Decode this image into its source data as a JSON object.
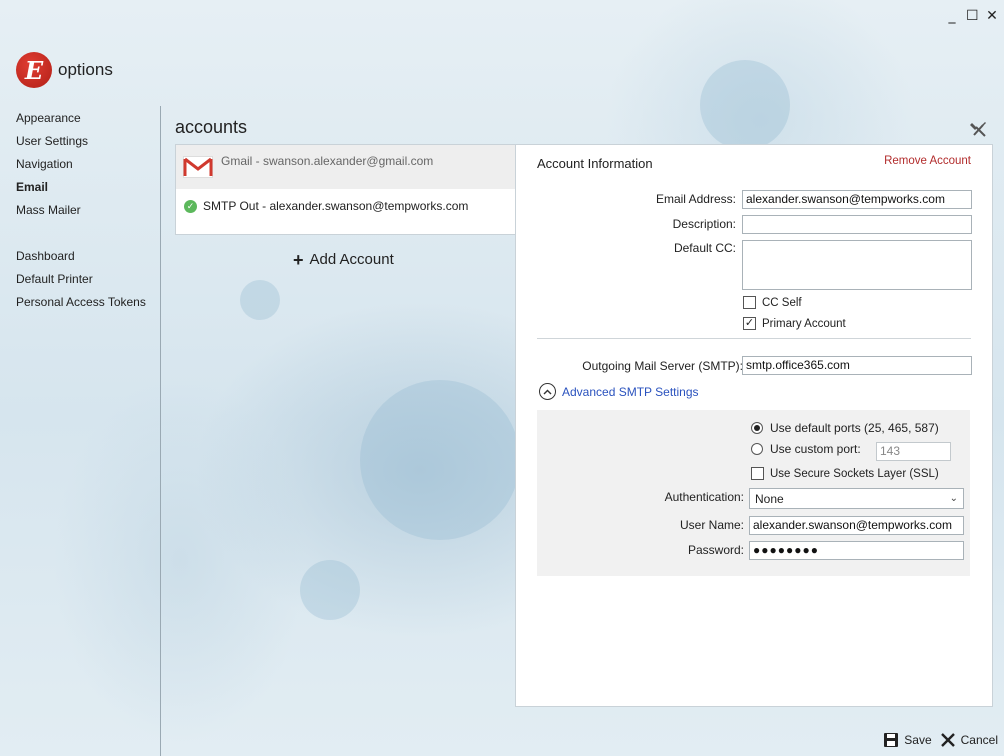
{
  "window": {
    "minimize_icon": "minimize-icon",
    "maximize_icon": "maximize-icon",
    "close_icon": "close-icon"
  },
  "app": {
    "logo_letter": "E",
    "title": "options",
    "brand_color": "#c8261d"
  },
  "sidebar": {
    "items": [
      {
        "label": "Appearance",
        "active": false
      },
      {
        "label": "User Settings",
        "active": false
      },
      {
        "label": "Navigation",
        "active": false
      },
      {
        "label": "Email",
        "active": true
      },
      {
        "label": "Mass Mailer",
        "active": false
      },
      {
        "label": "Dashboard",
        "active": false
      },
      {
        "label": "Default Printer",
        "active": false
      },
      {
        "label": "Personal Access Tokens",
        "active": false
      }
    ]
  },
  "accounts": {
    "title": "accounts",
    "list": [
      {
        "label": "Gmail - swanson.alexander@gmail.com",
        "icon": "gmail-icon",
        "selected": true
      },
      {
        "label": "SMTP Out - alexander.swanson@tempworks.com",
        "icon": "check-circle-icon",
        "selected": false
      }
    ],
    "add_label": "Add Account"
  },
  "account_info": {
    "heading": "Account Information",
    "remove_label": "Remove Account",
    "email_label": "Email Address:",
    "email_value": "alexander.swanson@tempworks.com",
    "description_label": "Description:",
    "description_value": "",
    "cc_label": "Default CC:",
    "cc_value": "",
    "cc_self_label": "CC Self",
    "cc_self_checked": false,
    "primary_label": "Primary Account",
    "primary_checked": true,
    "smtp_label": "Outgoing Mail Server (SMTP):",
    "smtp_value": "smtp.office365.com",
    "advanced_label": "Advanced SMTP Settings"
  },
  "advanced": {
    "default_ports_label": "Use default ports (25, 465, 587)",
    "default_ports_selected": true,
    "custom_port_label": "Use custom port:",
    "custom_port_value": "143",
    "ssl_label": "Use Secure Sockets Layer (SSL)",
    "ssl_checked": false,
    "auth_label": "Authentication:",
    "auth_value": "None",
    "username_label": "User Name:",
    "username_value": "alexander.swanson@tempworks.com",
    "password_label": "Password:",
    "password_value": "●●●●●●●●"
  },
  "footer": {
    "save_label": "Save",
    "cancel_label": "Cancel"
  }
}
